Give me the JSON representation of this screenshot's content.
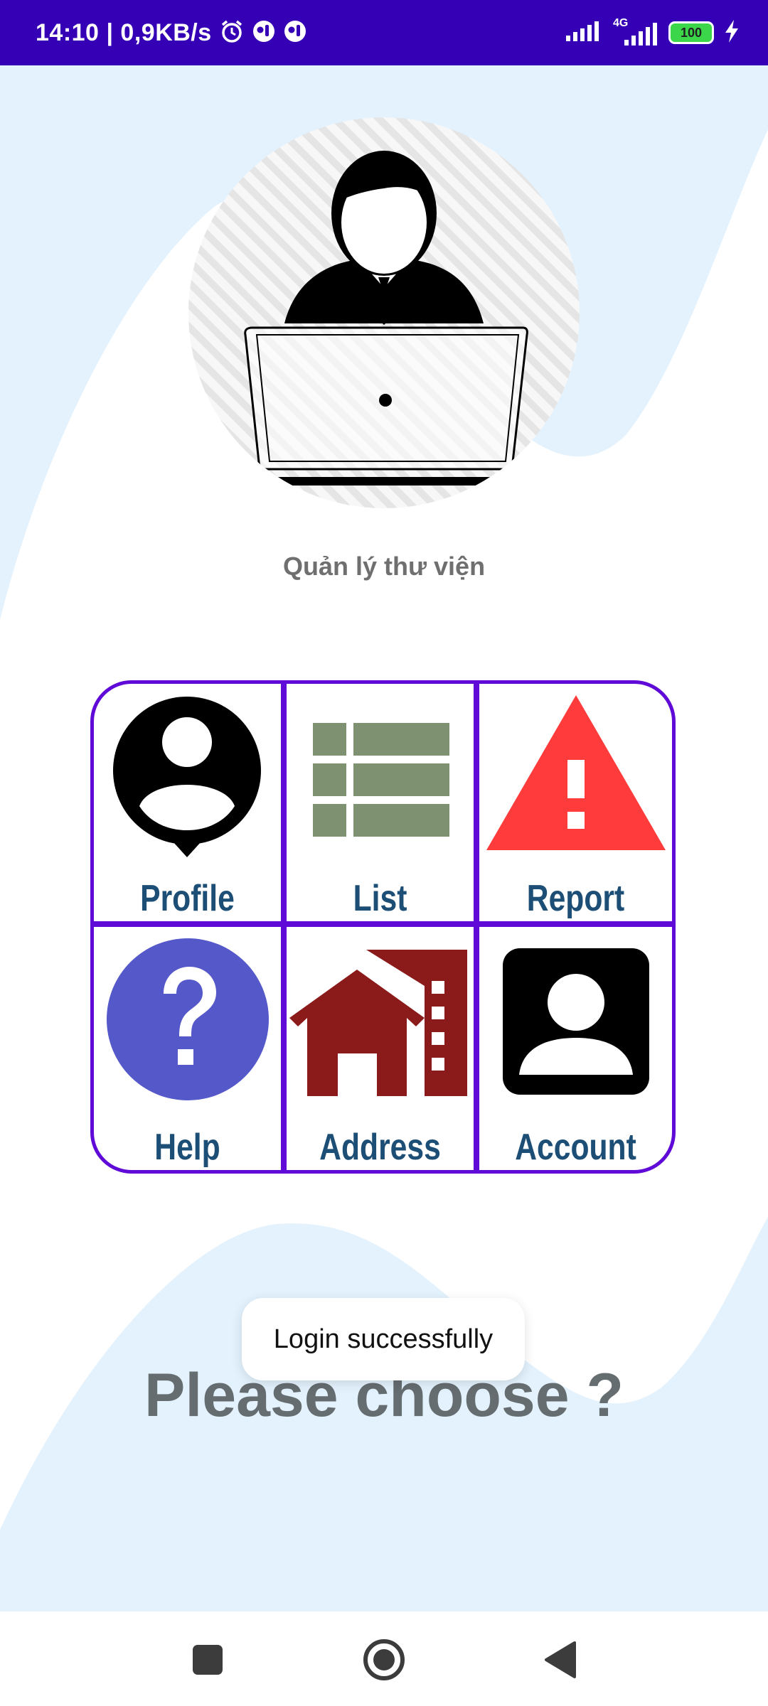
{
  "status_bar": {
    "time": "14:10",
    "network_speed": "| 0,9KB/s",
    "network_type": "4G",
    "battery_level": "100",
    "icons": [
      "alarm-icon",
      "notification-icon",
      "notification-icon",
      "signal-icon",
      "signal-4g-icon",
      "battery-icon",
      "charging-icon"
    ]
  },
  "header": {
    "app_title": "Quản lý thư viện",
    "avatar_icon": "person-laptop-icon"
  },
  "menu": {
    "items": [
      {
        "label": "Profile",
        "icon": "profile-pin-icon"
      },
      {
        "label": "List",
        "icon": "list-icon"
      },
      {
        "label": "Report",
        "icon": "warning-icon"
      },
      {
        "label": "Help",
        "icon": "help-icon"
      },
      {
        "label": "Address",
        "icon": "building-icon"
      },
      {
        "label": "Account",
        "icon": "account-icon"
      }
    ]
  },
  "toast": {
    "message": "Login successfully"
  },
  "prompt": {
    "text": "Please choose ?"
  },
  "nav_bar": {
    "icons": [
      "recents-icon",
      "home-icon",
      "back-icon"
    ]
  },
  "colors": {
    "status_bar": "#3500b5",
    "grid_border": "#5f0ad6",
    "label_text": "#1d4e75",
    "background_wave": "#e3f2fd",
    "list_icon": "#7e9272",
    "report_icon": "#ff3b3b",
    "help_icon": "#5558c9",
    "address_icon": "#8b1a1a"
  }
}
